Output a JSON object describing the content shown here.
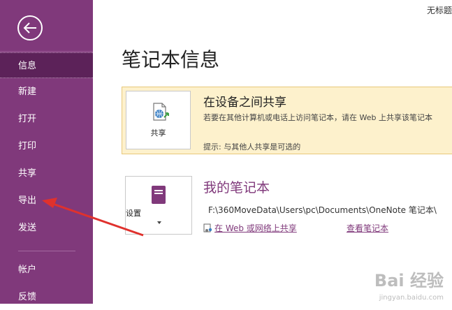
{
  "window": {
    "title": "无标题"
  },
  "sidebar": {
    "items": [
      {
        "label": "信息"
      },
      {
        "label": "新建"
      },
      {
        "label": "打开"
      },
      {
        "label": "打印"
      },
      {
        "label": "共享"
      },
      {
        "label": "导出"
      },
      {
        "label": "发送"
      },
      {
        "label": "帐户"
      },
      {
        "label": "反馈"
      }
    ],
    "active": "信息"
  },
  "main": {
    "title": "笔记本信息",
    "share_section": {
      "button_label": "共享",
      "heading": "在设备之间共享",
      "description": "若要在其他计算机或电话上访问笔记本，请在 Web 上共享该笔记本",
      "hint": "提示: 与其他人共享是可选的"
    },
    "notebook_section": {
      "button_label": "设置",
      "title": "我的笔记本",
      "path": "F:\\360MoveData\\Users\\pc\\Documents\\OneNote 笔记本\\",
      "share_link": "在 Web 或网络上共享",
      "view_link": "查看笔记本"
    }
  },
  "watermark": {
    "text": "Bai 经验",
    "sub": "jingyan.baidu.com"
  },
  "colors": {
    "sidebar": "#80397b",
    "active": "#5c2259",
    "accent": "#80397b",
    "panel": "#fdf1cc"
  }
}
